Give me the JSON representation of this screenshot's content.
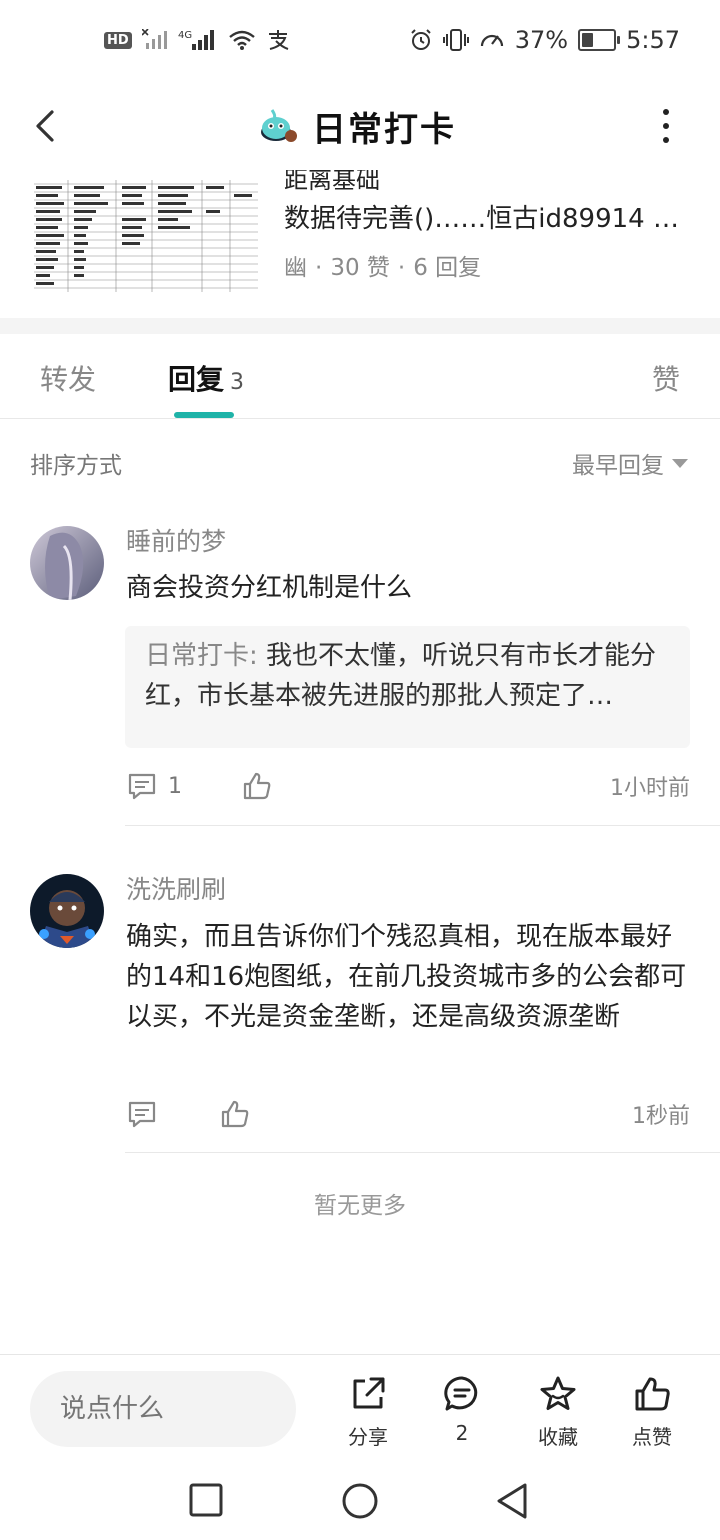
{
  "status_bar": {
    "hd": "HD",
    "battery": "37%",
    "battery_level": 0.37,
    "time": "5:57"
  },
  "header": {
    "title": "日常打卡"
  },
  "post": {
    "partial_title": "距离基础",
    "description": "数据待完善()……恒古id89914 1…",
    "author": "幽",
    "likes": "30 赞",
    "replies": "6 回复"
  },
  "tabs": {
    "forward": "转发",
    "reply": "回复",
    "reply_count": "3",
    "like": "赞"
  },
  "sort": {
    "label": "排序方式",
    "value": "最早回复"
  },
  "comments": [
    {
      "name": "睡前的梦",
      "text": "商会投资分红机制是什么",
      "quote_author": "日常打卡",
      "quote_sep": ":",
      "quote_text": "我也不太懂，听说只有市长才能分红，市长基本被先进服的那批人预定了…",
      "reply_count": "1",
      "time": "1小时前"
    },
    {
      "name": "洗洗刷刷",
      "text": "确实，而且告诉你们个残忍真相，现在版本最好的14和16炮图纸，在前几投资城市多的公会都可以买，不光是资金垄断，还是高级资源垄断",
      "time": "1秒前"
    }
  ],
  "no_more": "暂无更多",
  "bottom_bar": {
    "placeholder": "说点什么",
    "share": "分享",
    "comment_count": "2",
    "collect": "收藏",
    "like": "点赞"
  },
  "colors": {
    "accent": "#1fb3a8"
  }
}
